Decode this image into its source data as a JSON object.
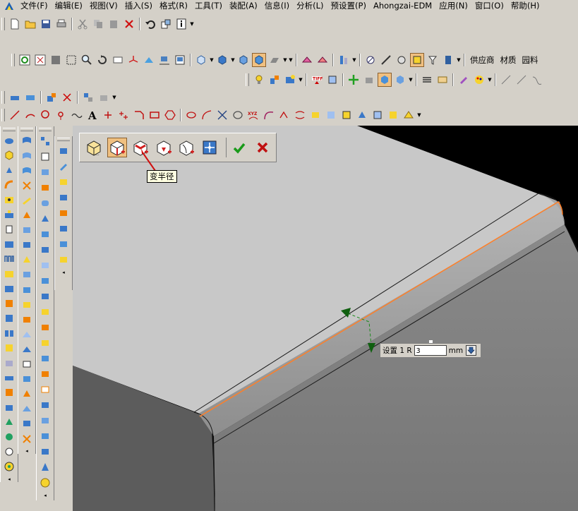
{
  "menubar": {
    "items": [
      "文件(F)",
      "编辑(E)",
      "视图(V)",
      "插入(S)",
      "格式(R)",
      "工具(T)",
      "装配(A)",
      "信息(I)",
      "分析(L)",
      "预设置(P)",
      "Ahongzai-EDM",
      "应用(N)",
      "窗口(O)",
      "帮助(H)"
    ]
  },
  "toolbar": {
    "supplier_label": "供应商",
    "material_label": "材质",
    "library_label": "园料"
  },
  "blend_toolbar": {
    "tooltip": "变半径"
  },
  "param_box": {
    "prefix": "设置 1 R",
    "value": "3",
    "unit": "mm"
  },
  "colors": {
    "face_top": "#c8c8c8",
    "face_front": "#7f7f7f",
    "face_left": "#5c5c5c",
    "blend_edge": "#ff7f27",
    "viewport_bg": "#000000"
  }
}
